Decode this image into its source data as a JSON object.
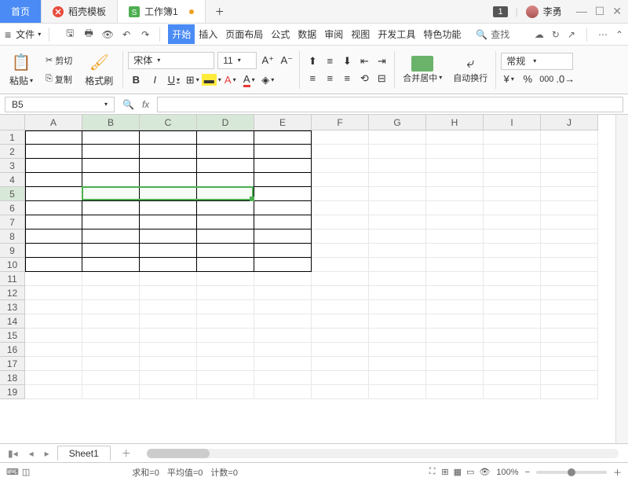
{
  "titlebar": {
    "home_tab": "首页",
    "template_tab": "稻壳模板",
    "doc_tab": "工作簿1",
    "badge": "1",
    "username": "李勇"
  },
  "menubar": {
    "file": "文件",
    "tabs": [
      "开始",
      "插入",
      "页面布局",
      "公式",
      "数据",
      "审阅",
      "视图",
      "开发工具",
      "特色功能"
    ],
    "search": "查找"
  },
  "ribbon": {
    "paste": "粘贴",
    "cut": "剪切",
    "copy": "复制",
    "format_painter": "格式刷",
    "font_name": "宋体",
    "font_size": "11",
    "merge": "合并居中",
    "wrap": "自动换行",
    "number_format": "常规"
  },
  "formula": {
    "name_box": "B5"
  },
  "columns": [
    "A",
    "B",
    "C",
    "D",
    "E",
    "F",
    "G",
    "H",
    "I",
    "J"
  ],
  "rows": [
    "1",
    "2",
    "3",
    "4",
    "5",
    "6",
    "7",
    "8",
    "9",
    "10",
    "11",
    "12",
    "13",
    "14",
    "15",
    "16",
    "17",
    "18",
    "19"
  ],
  "sheet": {
    "tab": "Sheet1"
  },
  "status": {
    "sum": "求和=0",
    "avg": "平均值=0",
    "count": "计数=0",
    "zoom": "100%"
  },
  "selection": {
    "col_start": 1,
    "col_end": 3,
    "row": 4
  },
  "borders": {
    "col_start": 0,
    "col_end": 4,
    "row_start": 0,
    "row_end": 9
  }
}
